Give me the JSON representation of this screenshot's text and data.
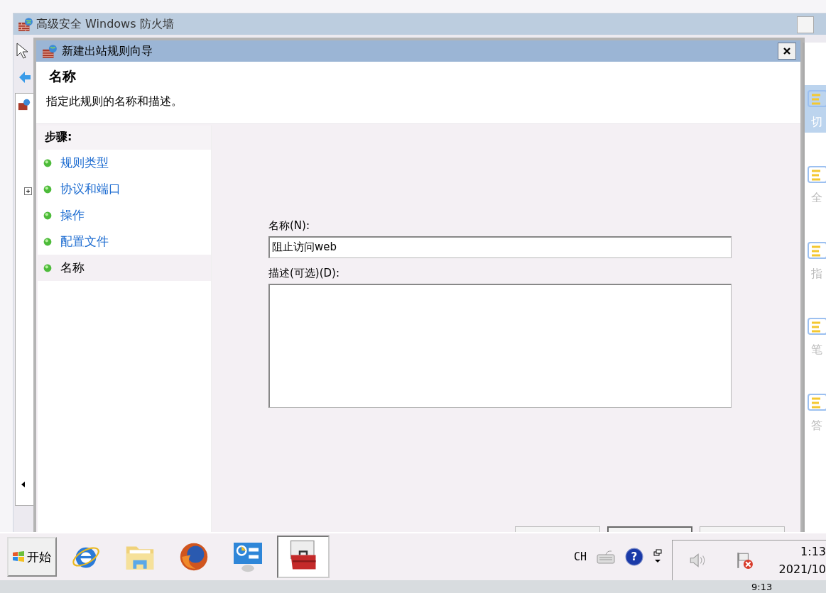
{
  "main_window": {
    "title": "高级安全 Windows 防火墙"
  },
  "dialog": {
    "title": "新建出站规则向导",
    "heading": "名称",
    "subtitle": "指定此规则的名称和描述。"
  },
  "steps": {
    "title": "步骤:",
    "items": [
      {
        "label": "规则类型",
        "selected": false
      },
      {
        "label": "协议和端口",
        "selected": false
      },
      {
        "label": "操作",
        "selected": false
      },
      {
        "label": "配置文件",
        "selected": false
      },
      {
        "label": "名称",
        "selected": true
      }
    ]
  },
  "form": {
    "name_label": "名称(N):",
    "name_value": "阻止访问web",
    "description_label": "描述(可选)(D):"
  },
  "wizard_buttons": [
    {
      "default": false
    },
    {
      "default": true
    },
    {
      "default": false
    }
  ],
  "side_toolbar": {
    "items": [
      {
        "label": "切",
        "selected": true
      },
      {
        "label": "全",
        "selected": false
      },
      {
        "label": "指",
        "selected": false
      },
      {
        "label": "笔",
        "selected": false
      },
      {
        "label": "答",
        "selected": false
      }
    ]
  },
  "taskbar": {
    "start": "开始",
    "apps": [
      {
        "kind": "browser",
        "selected": false
      },
      {
        "kind": "folder",
        "selected": false
      },
      {
        "kind": "fox",
        "selected": false
      },
      {
        "kind": "dashboard",
        "selected": false
      },
      {
        "kind": "toolbox",
        "selected": true
      }
    ],
    "language": "CH",
    "help": "?",
    "time": "1:13",
    "date": "2021/10"
  },
  "host_taskbar": {
    "time": "9:13"
  }
}
